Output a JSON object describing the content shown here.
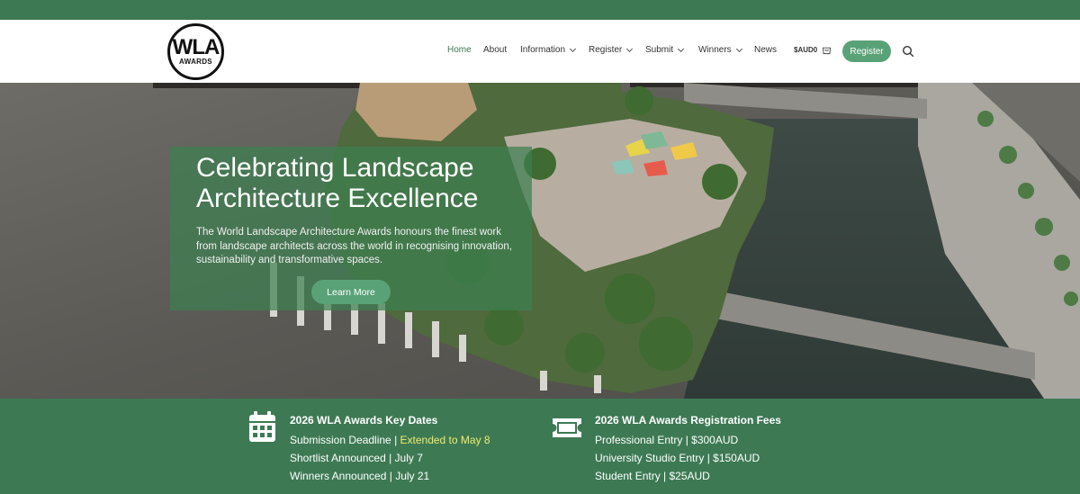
{
  "logo": {
    "main": "WLA",
    "sub": "AWARDS"
  },
  "nav": {
    "items": [
      {
        "label": "Home"
      },
      {
        "label": "About"
      },
      {
        "label": "Information"
      },
      {
        "label": "Register"
      },
      {
        "label": "Submit"
      },
      {
        "label": "Winners"
      },
      {
        "label": "News"
      }
    ],
    "cart_label": "$AUD0",
    "register_button": "Register"
  },
  "hero": {
    "title": "Celebrating Landscape Architecture Excellence",
    "text": "The World Landscape Architecture Awards honours the finest work from landscape architects across the world in recognising innovation, sustainability and transformative spaces.",
    "cta": "Learn More"
  },
  "key_dates": {
    "title": "2026 WLA Awards Key Dates",
    "submission_label": "Submission Deadline | ",
    "submission_value": "Extended to May 8",
    "shortlist": "Shortlist Announced | July 7",
    "winners": "Winners Announced | July 21"
  },
  "fees": {
    "title": "2026 WLA Awards Registration Fees",
    "professional": "Professional Entry | $300AUD",
    "university": "University Studio Entry | $150AUD",
    "student": "Student Entry | $25AUD"
  },
  "colors": {
    "brand_green": "#3d7a54",
    "button_green": "#59a277",
    "highlight_yellow": "#f2ea6d"
  },
  "icons": [
    "cart-icon",
    "search-icon",
    "calendar-icon",
    "ticket-icon",
    "chevron-down-icon"
  ]
}
